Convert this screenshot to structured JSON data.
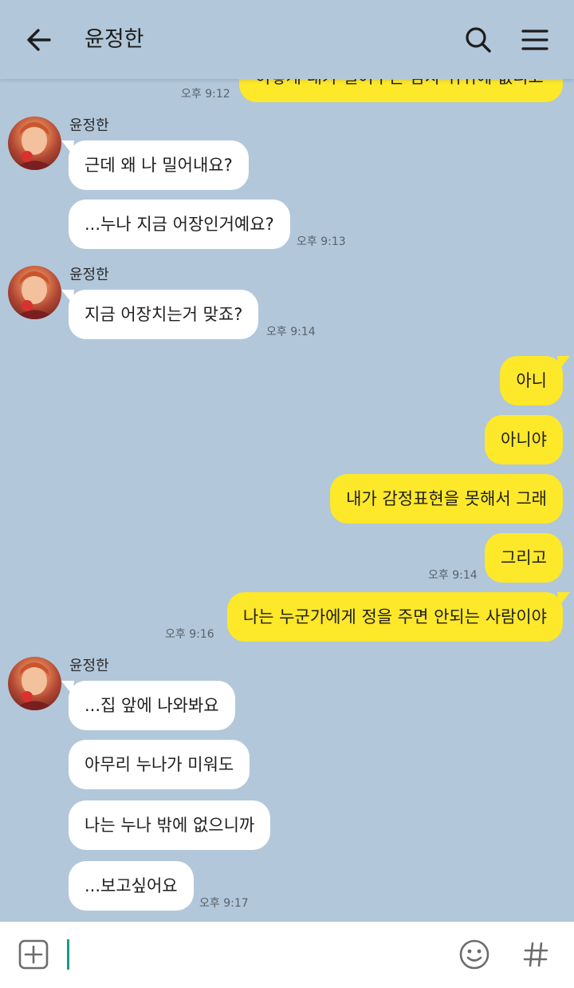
{
  "header": {
    "title": "윤정한"
  },
  "input": {
    "placeholder": ""
  },
  "colors": {
    "background": "#b2c7da",
    "incoming_bubble": "#ffffff",
    "outgoing_bubble": "#fde82a",
    "caret": "#1c9a8a"
  },
  "icons": {
    "back": "arrow-left-icon",
    "search": "search-icon",
    "menu": "hamburger-menu-icon",
    "plus": "plus-square-icon",
    "emoji": "smiley-icon",
    "hash": "hash-icon"
  },
  "messages": [
    {
      "dir": "out",
      "text": "이렇게 내가 밀어주는 감자 뒤뷔에 없니고",
      "time": "오후 9:12"
    },
    {
      "sender": "윤정한",
      "dir": "in",
      "text": "근데 왜 나 밀어내요?",
      "time": ""
    },
    {
      "dir": "in",
      "text": "...누나 지금 어장인거예요?",
      "time": "오후 9:13"
    },
    {
      "sender": "윤정한",
      "dir": "in",
      "text": "지금 어장치는거 맞죠?",
      "time": "오후 9:14"
    },
    {
      "dir": "out",
      "text": "아니",
      "time": ""
    },
    {
      "dir": "out",
      "text": "아니야",
      "time": ""
    },
    {
      "dir": "out",
      "text": "내가 감정표현을 못해서 그래",
      "time": ""
    },
    {
      "dir": "out",
      "text": "그리고",
      "time": "오후 9:14"
    },
    {
      "dir": "out",
      "text": "나는 누군가에게 정을 주면 안되는 사람이야",
      "time": "오후 9:16"
    },
    {
      "sender": "윤정한",
      "dir": "in",
      "text": "...집 앞에 나와봐요",
      "time": ""
    },
    {
      "dir": "in",
      "text": "아무리 누나가 미워도",
      "time": ""
    },
    {
      "dir": "in",
      "text": "나는 누나 밖에 없으니까",
      "time": ""
    },
    {
      "dir": "in",
      "text": "...보고싶어요",
      "time": "오후 9:17"
    }
  ]
}
